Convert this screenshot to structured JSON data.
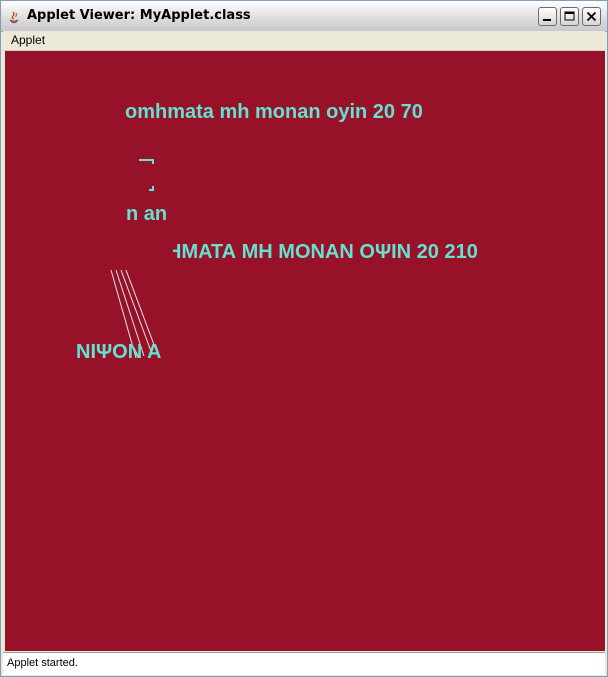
{
  "window": {
    "title": "Applet Viewer: MyApplet.class",
    "icon": "java-icon",
    "controls": {
      "minimize": "minimize-icon",
      "maximize": "maximize-icon",
      "close": "close-icon"
    }
  },
  "menubar": {
    "items": [
      {
        "label": "Applet"
      }
    ]
  },
  "applet": {
    "background_color": "#971128",
    "text_color": "#66e0d0",
    "texts": [
      "omhmata mh monan oyin 20 70",
      "n an",
      "ΗΜΑΤΑ ΜΗ ΜΟΝΑΝ ΟΨΙΝ 20 210",
      "ΝΙΨΟΝ Α"
    ]
  },
  "status": {
    "text": "Applet started."
  }
}
